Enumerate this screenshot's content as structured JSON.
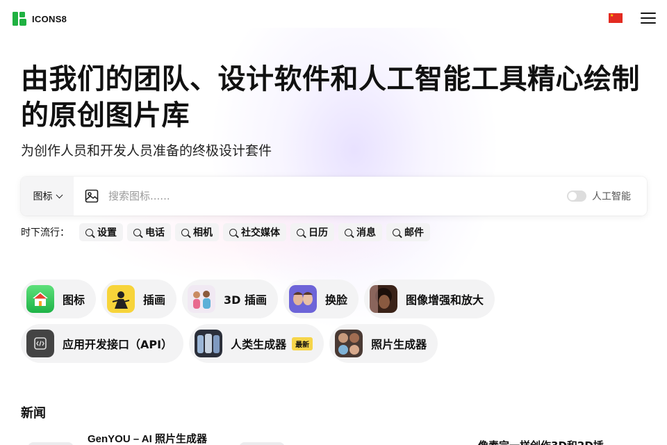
{
  "header": {
    "logo_text": "ICONS8",
    "logo_icon": "icons8-logo-icon",
    "flag_icon": "china-flag-icon",
    "menu_icon": "hamburger-menu-icon"
  },
  "hero": {
    "title": "由我们的团队、设计软件和人工智能工具精心绘制的原创图片库",
    "subtitle": "为创作人员和开发人员准备的终极设计套件"
  },
  "search": {
    "type_label": "图标",
    "placeholder": "搜索图标......",
    "value": "",
    "ai_label": "人工智能",
    "ai_enabled": false
  },
  "trending": {
    "label": "时下流行：",
    "tags": [
      "设置",
      "电话",
      "相机",
      "社交媒体",
      "日历",
      "消息",
      "邮件"
    ]
  },
  "categories": [
    {
      "label": "图标",
      "icon": "home-app-icon"
    },
    {
      "label": "插画",
      "icon": "illustration-icon"
    },
    {
      "label": "3D 插画",
      "icon": "3d-illustration-icon"
    },
    {
      "label": "换脸",
      "icon": "face-swap-icon"
    },
    {
      "label": "图像增强和放大",
      "icon": "image-upscaler-icon"
    },
    {
      "label": "应用开发接口（API）",
      "icon": "api-code-icon"
    },
    {
      "label": "人类生成器",
      "icon": "human-generator-icon",
      "badge": "最新"
    },
    {
      "label": "照片生成器",
      "icon": "photo-generator-icon"
    }
  ],
  "news": {
    "title": "新闻",
    "items": [
      "GenYOU – AI 照片生成器",
      "像素完一样创作3D和2D插"
    ]
  },
  "colors": {
    "brand_green": "#1fb141",
    "flag_red": "#e32b21",
    "badge_yellow": "#f6d54a"
  }
}
